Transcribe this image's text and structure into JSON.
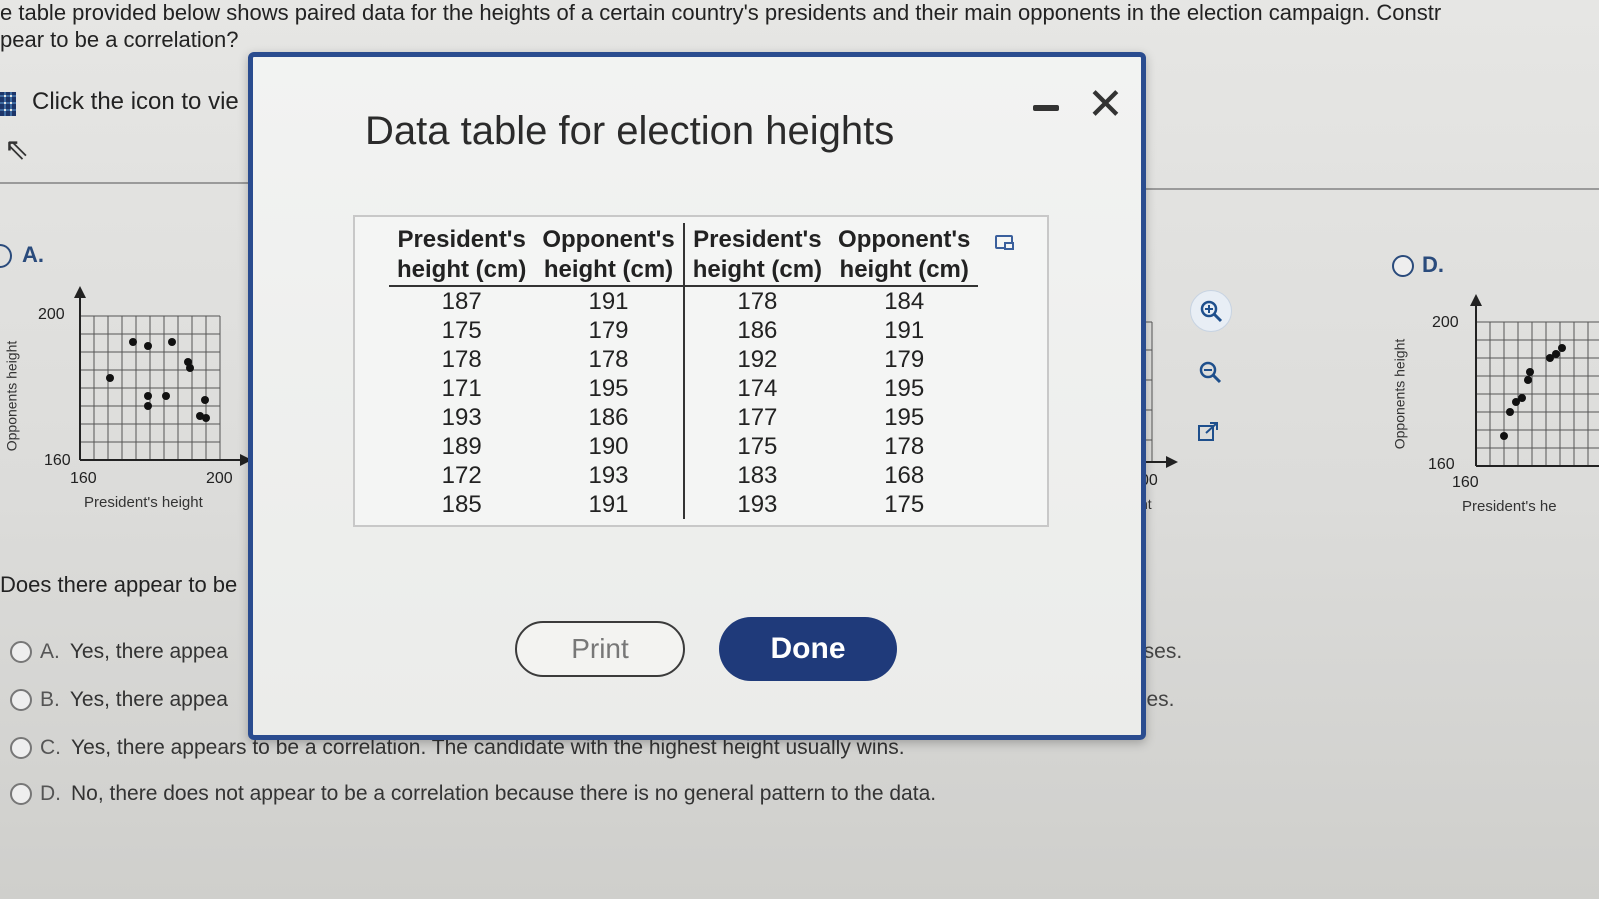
{
  "question": {
    "line1": "e table provided below shows paired data for the heights of a certain country's presidents and their main opponents in the election campaign. Constr",
    "line2": "pear to be a correlation?",
    "click_text": "Click the icon to vie"
  },
  "options_top": {
    "a": "A.",
    "d": "D."
  },
  "plot_left": {
    "y_axis_label": "Opponents height",
    "x_axis_label": "President's height",
    "y_top": "200",
    "y_bottom": "160",
    "x_left": "160",
    "x_right": "200"
  },
  "plot_right": {
    "y_axis_label": "Opponents height",
    "x_axis_label": "President's he",
    "y_top": "200",
    "y_bottom": "160",
    "x_left": "160"
  },
  "plot_middle_partial": {
    "x_right": "00",
    "x_label": "nt"
  },
  "question2": "Does there appear to be",
  "choices": [
    {
      "letter": "A.",
      "text": "Yes, there appea"
    },
    {
      "letter": "B.",
      "text": "Yes, there appea"
    },
    {
      "letter": "C.",
      "text": "Yes, there appears to be a correlation. The candidate with the highest height usually wins."
    },
    {
      "letter": "D.",
      "text": "No, there does not appear to be a correlation because there is no general pattern to the data."
    }
  ],
  "choice_tails": {
    "a": "ases.",
    "b": "ses."
  },
  "modal": {
    "title": "Data table for election heights",
    "headers": [
      [
        "President's",
        "height (cm)"
      ],
      [
        "Opponent's",
        "height (cm)"
      ],
      [
        "President's",
        "height (cm)"
      ],
      [
        "Opponent's",
        "height (cm)"
      ]
    ],
    "rows": [
      [
        "187",
        "191",
        "178",
        "184"
      ],
      [
        "175",
        "179",
        "186",
        "191"
      ],
      [
        "178",
        "178",
        "192",
        "179"
      ],
      [
        "171",
        "195",
        "174",
        "195"
      ],
      [
        "193",
        "186",
        "177",
        "195"
      ],
      [
        "189",
        "190",
        "175",
        "178"
      ],
      [
        "172",
        "193",
        "183",
        "168"
      ],
      [
        "185",
        "191",
        "193",
        "175"
      ]
    ],
    "print_label": "Print",
    "done_label": "Done"
  },
  "colors": {
    "accent": "#1f3a7a",
    "border": "#2a4c8f"
  }
}
